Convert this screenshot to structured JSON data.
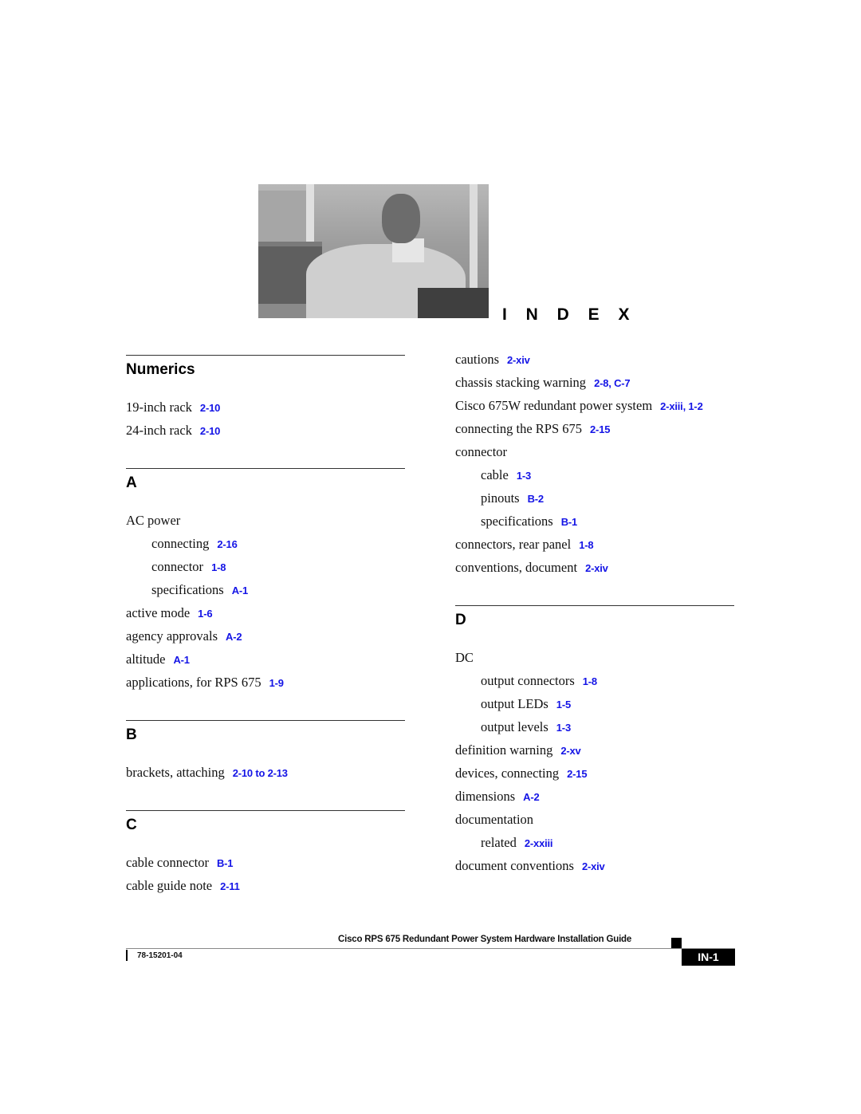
{
  "header": {
    "image_alt": "Photo of a man seated on a sofa",
    "title": "I N D E X"
  },
  "left_column": {
    "sections": [
      {
        "heading": "Numerics",
        "entries": [
          {
            "text": "19-inch rack",
            "refs": "2-10",
            "sub": false
          },
          {
            "text": "24-inch rack",
            "refs": "2-10",
            "sub": false
          }
        ]
      },
      {
        "heading": "A",
        "entries": [
          {
            "text": "AC power",
            "refs": "",
            "sub": false
          },
          {
            "text": "connecting",
            "refs": "2-16",
            "sub": true
          },
          {
            "text": "connector",
            "refs": "1-8",
            "sub": true
          },
          {
            "text": "specifications",
            "refs": "A-1",
            "sub": true
          },
          {
            "text": "active mode",
            "refs": "1-6",
            "sub": false
          },
          {
            "text": "agency approvals",
            "refs": "A-2",
            "sub": false
          },
          {
            "text": "altitude",
            "refs": "A-1",
            "sub": false
          },
          {
            "text": "applications, for RPS 675",
            "refs": "1-9",
            "sub": false
          }
        ]
      },
      {
        "heading": "B",
        "entries": [
          {
            "text": "brackets, attaching",
            "refs": "2-10 to 2-13",
            "sub": false
          }
        ]
      },
      {
        "heading": "C",
        "entries": [
          {
            "text": "cable connector",
            "refs": "B-1",
            "sub": false
          },
          {
            "text": "cable guide note",
            "refs": "2-11",
            "sub": false
          }
        ]
      }
    ]
  },
  "right_column": {
    "continued_entries": [
      {
        "text": "cautions",
        "refs": "2-xiv",
        "sub": false
      },
      {
        "text": "chassis stacking warning",
        "refs": "2-8, C-7",
        "sub": false
      },
      {
        "text": "Cisco 675W redundant power system",
        "refs": "2-xiii, 1-2",
        "sub": false
      },
      {
        "text": "connecting the RPS 675",
        "refs": "2-15",
        "sub": false
      },
      {
        "text": "connector",
        "refs": "",
        "sub": false
      },
      {
        "text": "cable",
        "refs": "1-3",
        "sub": true
      },
      {
        "text": "pinouts",
        "refs": "B-2",
        "sub": true
      },
      {
        "text": "specifications",
        "refs": "B-1",
        "sub": true
      },
      {
        "text": "connectors, rear panel",
        "refs": "1-8",
        "sub": false
      },
      {
        "text": "conventions, document",
        "refs": "2-xiv",
        "sub": false
      }
    ],
    "sections": [
      {
        "heading": "D",
        "entries": [
          {
            "text": "DC",
            "refs": "",
            "sub": false
          },
          {
            "text": "output connectors",
            "refs": "1-8",
            "sub": true
          },
          {
            "text": "output LEDs",
            "refs": "1-5",
            "sub": true
          },
          {
            "text": "output levels",
            "refs": "1-3",
            "sub": true
          },
          {
            "text": "definition warning",
            "refs": "2-xv",
            "sub": false
          },
          {
            "text": "devices, connecting",
            "refs": "2-15",
            "sub": false
          },
          {
            "text": "dimensions",
            "refs": "A-2",
            "sub": false
          },
          {
            "text": "documentation",
            "refs": "",
            "sub": false
          },
          {
            "text": "related",
            "refs": "2-xxiii",
            "sub": true
          },
          {
            "text": "document conventions",
            "refs": "2-xiv",
            "sub": false
          }
        ]
      }
    ]
  },
  "footer": {
    "guide_title": "Cisco RPS 675 Redundant Power System Hardware Installation Guide",
    "doc_number": "78-15201-04",
    "page_label": "IN-1"
  },
  "colors": {
    "link": "#1414e6",
    "text": "#111111",
    "rule": "#333333"
  }
}
